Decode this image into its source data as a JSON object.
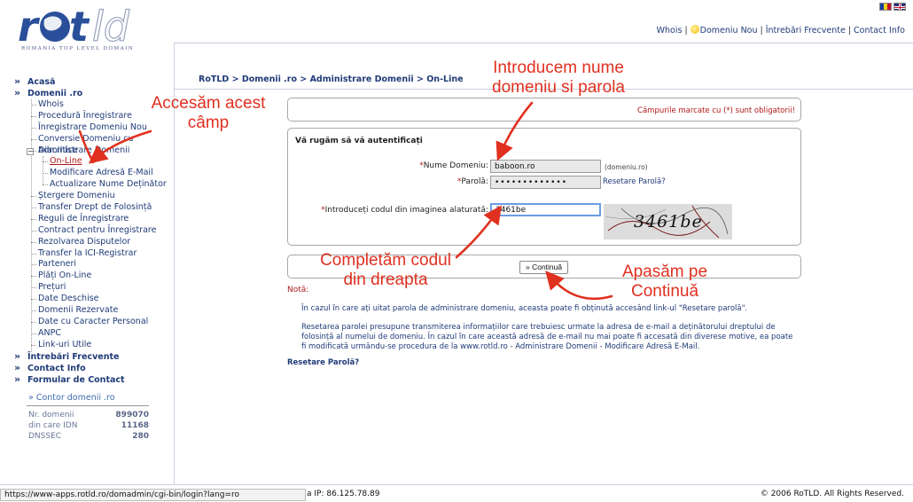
{
  "header": {
    "logo_text": "rotld",
    "logo_subtitle": "ROMANIA TOP LEVEL DOMAIN",
    "nav": [
      {
        "label": "Whois"
      },
      {
        "label": "Domeniu Nou"
      },
      {
        "label": "Întrebări Frecvente"
      },
      {
        "label": "Contact Info"
      }
    ],
    "flags": [
      "ro-flag",
      "uk-flag"
    ]
  },
  "sidebar": {
    "items": [
      {
        "label": "Acasă"
      },
      {
        "label": "Domenii .ro"
      },
      {
        "label": "Întrebări Frecvente"
      },
      {
        "label": "Contact Info"
      },
      {
        "label": "Formular de Contact"
      }
    ],
    "domenii_sub": [
      {
        "label": "Whois"
      },
      {
        "label": "Procedură Înregistrare"
      },
      {
        "label": "Înregistrare Domeniu Nou"
      },
      {
        "label": "Conversie Domeniu cu Diacritice"
      },
      {
        "label": "Administrare Domenii"
      },
      {
        "label": "On-Line"
      },
      {
        "label": "Modificare Adresă E-Mail"
      },
      {
        "label": "Actualizare Nume Deținător"
      },
      {
        "label": "Ștergere Domeniu"
      },
      {
        "label": "Transfer Drept de Folosință"
      },
      {
        "label": "Reguli de Înregistrare"
      },
      {
        "label": "Contract pentru Înregistrare"
      },
      {
        "label": "Rezolvarea Disputelor"
      },
      {
        "label": "Transfer la ICI-Registrar"
      },
      {
        "label": "Parteneri"
      },
      {
        "label": "Plăți On-Line"
      },
      {
        "label": "Prețuri"
      },
      {
        "label": "Date Deschise"
      },
      {
        "label": "Domenii Rezervate"
      },
      {
        "label": "Date cu Caracter Personal"
      },
      {
        "label": "ANPC"
      },
      {
        "label": "Link-uri Utile"
      }
    ]
  },
  "counter": {
    "title": "» Contor domenii .ro",
    "rows": [
      {
        "label": "Nr. domenii",
        "value": "899070"
      },
      {
        "label": "din care IDN",
        "value": "11168"
      },
      {
        "label": "DNSSEC",
        "value": "280"
      }
    ]
  },
  "breadcrumb": "RoTLD > Domenii .ro > Administrare Domenii > On-Line",
  "form": {
    "required_note": "Câmpurile marcate cu (*) sunt obligatorii!",
    "auth_title": "Vă rugăm să vă autentificați",
    "domain_label": "Nume Domeniu:",
    "domain_value": "baboon.ro",
    "domain_hint": "(domeniu.ro)",
    "password_label": "Parolă:",
    "password_value": "•••••••••••••",
    "reset_link": "Resetare Parolă?",
    "captcha_label": "Introduceți codul din imaginea alaturată:",
    "captcha_value": "3461be",
    "captcha_image_text": "3461be",
    "continue_button": "» Continuă"
  },
  "notes": {
    "label": "Notă:",
    "p1": "În cazul în care ați uitat parola de administrare domeniu, aceasta poate fi obținută accesând link-ul \"Resetare parolă\".",
    "p2": "Resetarea parolei presupune transmiterea informațiilor care trebuiesc urmate la adresa de e-mail a deținătorului dreptului de folosință al numelui de domeniu. În cazul în care această adresă de e-mail nu mai poate fi accesată din diverese motive, ea poate fi modificată urmându-se procedura de la www.rotld.ro - Administrare Domenii - Modificare Adresă E-Mail.",
    "reset_link": "Resetare Parolă?"
  },
  "footer": {
    "status_url": "https://www-apps.rotld.ro/domadmin/cgi-bin/login?lang=ro",
    "ip_text": "a IP: 86.125.78.89",
    "copyright": "© 2006 RoTLD.   All Rights Reserved."
  },
  "annotations": {
    "a1": "Accesăm acest câmp",
    "a2": "Introducem nume domeniu si parola",
    "a3": "Completăm codul din dreapta",
    "a4": "Apasăm pe Continuă"
  },
  "colors": {
    "link": "#1f3b78",
    "accent_red": "#b01818",
    "annotation": "#e03020"
  }
}
